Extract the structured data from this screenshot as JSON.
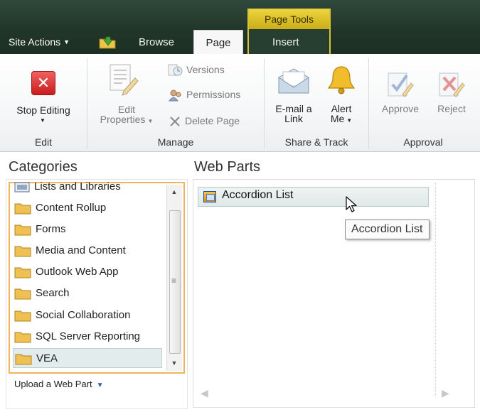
{
  "topbar": {
    "site_actions": "Site Actions",
    "contextual_group": "Page Tools",
    "tabs": [
      {
        "label": "Browse"
      },
      {
        "label": "Page"
      },
      {
        "label": "Insert"
      }
    ]
  },
  "ribbon": {
    "groups": {
      "edit": "Edit",
      "manage": "Manage",
      "share": "Share & Track",
      "approval": "Approval"
    },
    "buttons": {
      "stop_editing": "Stop Editing",
      "edit_properties_1": "Edit",
      "edit_properties_2": "Properties",
      "versions": "Versions",
      "permissions": "Permissions",
      "delete_page": "Delete Page",
      "email_1": "E-mail a",
      "email_2": "Link",
      "alert_1": "Alert",
      "alert_2": "Me",
      "approve": "Approve",
      "reject": "Reject"
    }
  },
  "categories": {
    "title": "Categories",
    "items": [
      {
        "label": "Lists and Libraries"
      },
      {
        "label": "Content Rollup"
      },
      {
        "label": "Forms"
      },
      {
        "label": "Media and Content"
      },
      {
        "label": "Outlook Web App"
      },
      {
        "label": "Search"
      },
      {
        "label": "Social Collaboration"
      },
      {
        "label": "SQL Server Reporting"
      },
      {
        "label": "VEA"
      }
    ],
    "selected": "VEA",
    "upload": "Upload a Web Part"
  },
  "webparts": {
    "title": "Web Parts",
    "items": [
      {
        "label": "Accordion List"
      }
    ],
    "tooltip": "Accordion List"
  },
  "colors": {
    "topbar": "#213629",
    "page_tools": "#e0c52c",
    "category_border": "#f0b45a",
    "selected_row": "#e3ecec"
  }
}
